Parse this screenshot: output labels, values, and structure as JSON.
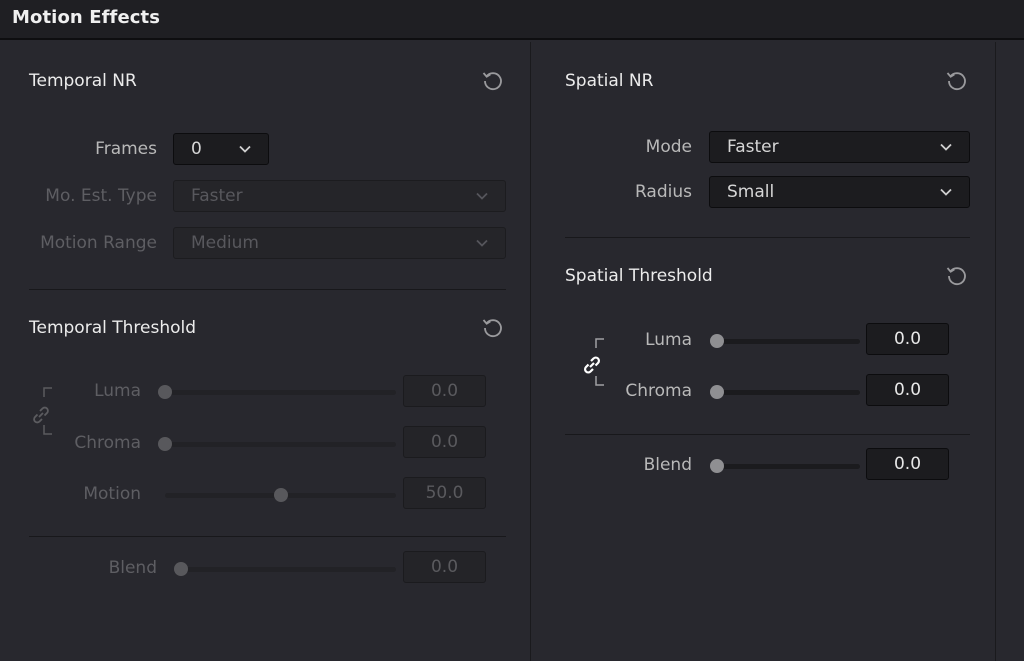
{
  "header": {
    "title": "Motion Effects"
  },
  "temporal_nr": {
    "title": "Temporal NR",
    "frames": {
      "label": "Frames",
      "value": "0"
    },
    "mo_est_type": {
      "label": "Mo. Est. Type",
      "value": "Faster",
      "enabled": false
    },
    "motion_range": {
      "label": "Motion Range",
      "value": "Medium",
      "enabled": false
    }
  },
  "temporal_threshold": {
    "title": "Temporal Threshold",
    "enabled": false,
    "luma": {
      "label": "Luma",
      "value": "0.0",
      "fraction": 0.0
    },
    "chroma": {
      "label": "Chroma",
      "value": "0.0",
      "fraction": 0.0
    },
    "motion": {
      "label": "Motion",
      "value": "50.0",
      "fraction": 0.5
    },
    "blend": {
      "label": "Blend",
      "value": "0.0",
      "fraction": 0.0
    }
  },
  "spatial_nr": {
    "title": "Spatial NR",
    "mode": {
      "label": "Mode",
      "value": "Faster"
    },
    "radius": {
      "label": "Radius",
      "value": "Small"
    }
  },
  "spatial_threshold": {
    "title": "Spatial Threshold",
    "luma": {
      "label": "Luma",
      "value": "0.0",
      "fraction": 0.0
    },
    "chroma": {
      "label": "Chroma",
      "value": "0.0",
      "fraction": 0.0
    },
    "blend": {
      "label": "Blend",
      "value": "0.0",
      "fraction": 0.0
    }
  },
  "icons": {
    "reset": "reset-icon",
    "link": "link-icon",
    "chevron": "chevron-down-icon"
  }
}
